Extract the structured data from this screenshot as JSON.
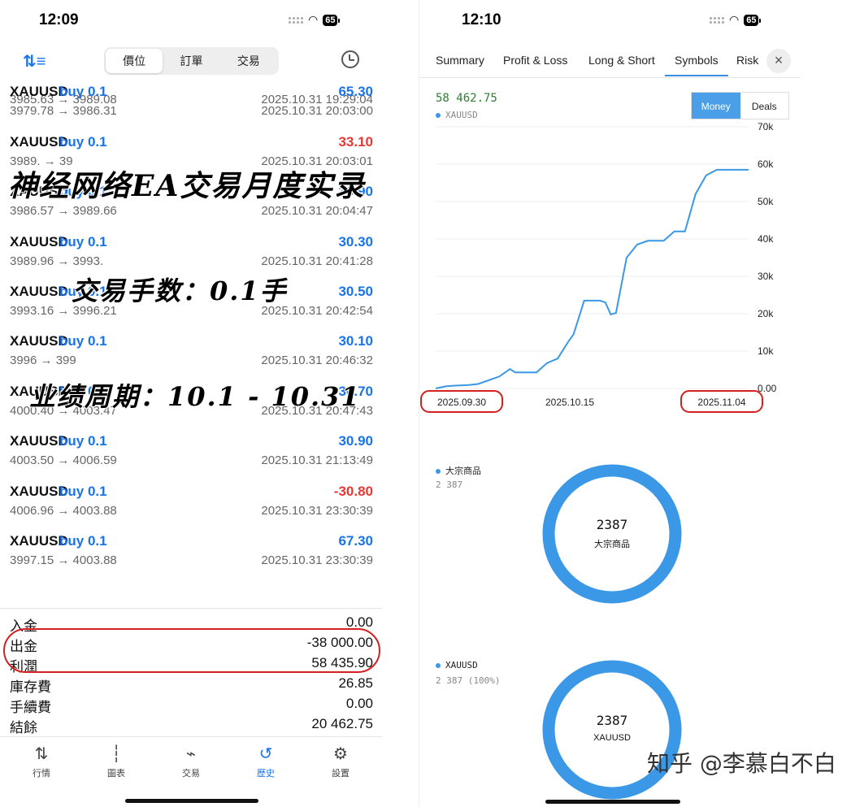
{
  "left": {
    "time": "12:09",
    "battery": "65",
    "segments": [
      "價位",
      "訂單",
      "交易"
    ],
    "active_segment": 0,
    "trades": [
      {
        "sym": "",
        "side": "",
        "pnl": "",
        "px": "3985.63 → 3989.08",
        "time": "2025.10.31 19:29:04",
        "neg": false
      },
      {
        "sym": "XAUUSD",
        "side": "buy 0.1",
        "pnl": "65.30",
        "px": "3979.78 → 3986.31",
        "time": "2025.10.31 20:03:00",
        "neg": false
      },
      {
        "sym": "XAUUSD",
        "side": "buy 0.1",
        "pnl": "33.10",
        "px": "3989.  → 39",
        "time": "2025.10.31 20:03:01",
        "neg": true
      },
      {
        "sym": "XAUUSD",
        "side": "buy 0.1",
        "pnl": "30.90",
        "px": "3986.57 → 3989.66",
        "time": "2025.10.31 20:04:47",
        "neg": false
      },
      {
        "sym": "XAUUSD",
        "side": "buy 0.1",
        "pnl": "30.30",
        "px": "3989.96 → 3993.  ",
        "time": "2025.10.31 20:41:28",
        "neg": false
      },
      {
        "sym": "XAUUSD",
        "side": "buy 0.1",
        "pnl": "30.50",
        "px": "3993.16 → 3996.21",
        "time": "2025.10.31 20:42:54",
        "neg": false
      },
      {
        "sym": "XAUUSD",
        "side": "buy 0.1",
        "pnl": "30.10",
        "px": "3996  → 399",
        "time": "2025.10.31 20:46:32",
        "neg": false
      },
      {
        "sym": "XAUUSD",
        "side": "buy 0.1",
        "pnl": "30.70",
        "px": "4000.40 → 4003.47",
        "time": "2025.10.31 20:47:43",
        "neg": false
      },
      {
        "sym": "XAUUSD",
        "side": "buy 0.1",
        "pnl": "30.90",
        "px": "4003.50 → 4006.59",
        "time": "2025.10.31 21:13:49",
        "neg": false
      },
      {
        "sym": "XAUUSD",
        "side": "buy 0.1",
        "pnl": "-30.80",
        "px": "4006.96 → 4003.88",
        "time": "2025.10.31 23:30:39",
        "neg": true
      },
      {
        "sym": "XAUUSD",
        "side": "buy 0.1",
        "pnl": "67.30",
        "px": "3997.15 → 4003.88",
        "time": "2025.10.31 23:30:39",
        "neg": false
      }
    ],
    "overlay_title": "神经网络EA交易月度实录",
    "overlay_lots": "交易手数：0.1手",
    "overlay_period": "业绩周期：10.1 - 10.31",
    "summary": [
      {
        "k": "入金",
        "v": "0.00"
      },
      {
        "k": "出金",
        "v": "-38 000.00"
      },
      {
        "k": "利潤",
        "v": "58 435.90"
      },
      {
        "k": "庫存費",
        "v": "26.85"
      },
      {
        "k": "手續費",
        "v": "0.00"
      },
      {
        "k": "結餘",
        "v": "20 462.75"
      }
    ],
    "tabs": [
      {
        "label": "行情",
        "icon": "⇅"
      },
      {
        "label": "圖表",
        "icon": "┆"
      },
      {
        "label": "交易",
        "icon": "⌁"
      },
      {
        "label": "歷史",
        "icon": "↺"
      },
      {
        "label": "設置",
        "icon": "⚙"
      }
    ],
    "active_tab": 3
  },
  "right": {
    "time": "12:10",
    "battery": "65",
    "tabs": [
      "Summary",
      "Profit & Loss",
      "Long & Short",
      "Symbols",
      "Risk"
    ],
    "active_tab": 3,
    "close_icon": "×",
    "balance": "58 462.75",
    "series_name": "XAUUSD",
    "toggle": [
      "Money",
      "Deals"
    ],
    "toggle_on": 0,
    "donut1": {
      "legend": "大宗商品",
      "legend_sub": "2 387",
      "value": "2387",
      "label": "大宗商品"
    },
    "donut2": {
      "legend": "XAUUSD",
      "legend_sub": "2 387 (100%)",
      "value": "2387",
      "label": "XAUUSD"
    }
  },
  "watermark": "知乎 @李慕白不白",
  "chart_data": {
    "type": "line",
    "x_labels": [
      "2025.09.30",
      "2025.10.15",
      "2025.11.04"
    ],
    "y_ticks": [
      "70k",
      "60k",
      "50k",
      "40k",
      "30k",
      "20k",
      "10k",
      "0.00"
    ],
    "ylim": [
      0,
      70000
    ],
    "series": [
      {
        "name": "XAUUSD",
        "color": "#3a98e6",
        "points": [
          [
            0,
            0
          ],
          [
            2,
            600
          ],
          [
            4,
            800
          ],
          [
            6,
            900
          ],
          [
            8,
            1200
          ],
          [
            10,
            2200
          ],
          [
            12,
            3200
          ],
          [
            14,
            5200
          ],
          [
            15,
            4300
          ],
          [
            17,
            4300
          ],
          [
            19,
            4300
          ],
          [
            21,
            6800
          ],
          [
            23,
            8000
          ],
          [
            25,
            12500
          ],
          [
            26,
            14500
          ],
          [
            28,
            23500
          ],
          [
            31,
            23500
          ],
          [
            32,
            23000
          ],
          [
            33,
            19800
          ],
          [
            34,
            20200
          ],
          [
            36,
            35000
          ],
          [
            38,
            38500
          ],
          [
            40,
            39500
          ],
          [
            43,
            39500
          ],
          [
            45,
            42000
          ],
          [
            47,
            42000
          ],
          [
            49,
            52000
          ],
          [
            51,
            57000
          ],
          [
            53,
            58500
          ],
          [
            59,
            58500
          ]
        ]
      }
    ],
    "x_range": [
      0,
      59
    ]
  }
}
